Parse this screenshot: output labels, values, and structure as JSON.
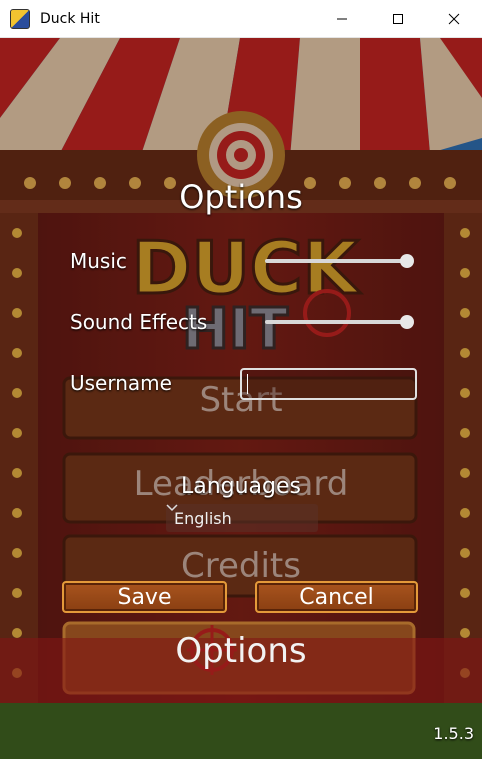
{
  "window": {
    "title": "Duck Hit"
  },
  "logo": {
    "line1": "DUCK",
    "line2": "HIT"
  },
  "menu_behind": {
    "start": "Start",
    "leaderboard": "Leaderboard",
    "credits": "Credits",
    "options": "Options"
  },
  "options_dialog": {
    "title": "Options",
    "music_label": "Music",
    "music_level": 1.0,
    "sound_effects_label": "Sound Effects",
    "sound_effects_level": 1.0,
    "username_label": "Username",
    "username_value": "",
    "languages_label": "Languages",
    "language_selected": "English",
    "save_label": "Save",
    "cancel_label": "Cancel"
  },
  "version": "1.5.3",
  "colors": {
    "accent_orange": "#e49a3a",
    "tent_red": "#c8201e",
    "tent_cream": "#f3e3bf"
  }
}
